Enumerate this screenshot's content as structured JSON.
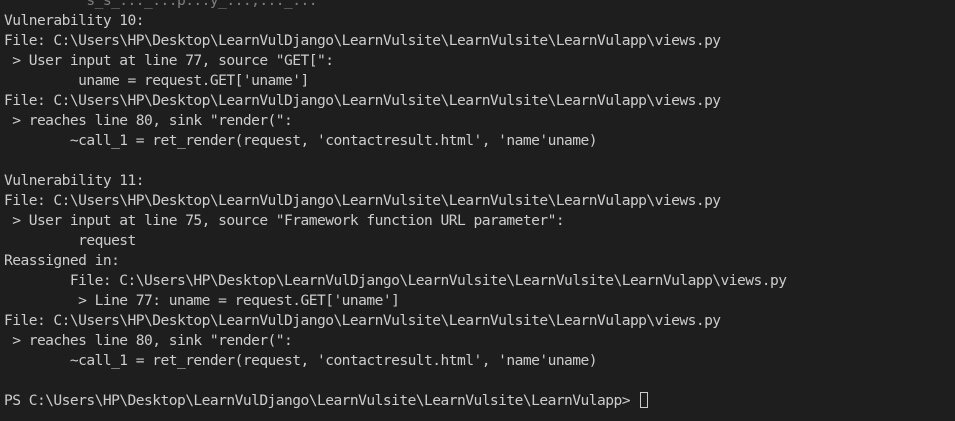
{
  "terminal": {
    "lines": [
      "          s_s_..._...p...y_...,..._...",
      "Vulnerability 10:",
      "File: C:\\Users\\HP\\Desktop\\LearnVulDjango\\LearnVulsite\\LearnVulsite\\LearnVulapp\\views.py",
      " > User input at line 77, source \"GET[\":",
      "         uname = request.GET['uname']",
      "File: C:\\Users\\HP\\Desktop\\LearnVulDjango\\LearnVulsite\\LearnVulsite\\LearnVulapp\\views.py",
      " > reaches line 80, sink \"render(\":",
      "        ~call_1 = ret_render(request, 'contactresult.html', 'name'uname)",
      "",
      "Vulnerability 11:",
      "File: C:\\Users\\HP\\Desktop\\LearnVulDjango\\LearnVulsite\\LearnVulsite\\LearnVulapp\\views.py",
      " > User input at line 75, source \"Framework function URL parameter\":",
      "         request",
      "Reassigned in:",
      "        File: C:\\Users\\HP\\Desktop\\LearnVulDjango\\LearnVulsite\\LearnVulsite\\LearnVulapp\\views.py",
      "         > Line 77: uname = request.GET['uname']",
      "File: C:\\Users\\HP\\Desktop\\LearnVulDjango\\LearnVulsite\\LearnVulsite\\LearnVulapp\\views.py",
      " > reaches line 80, sink \"render(\":",
      "        ~call_1 = ret_render(request, 'contactresult.html', 'name'uname)",
      "",
      ""
    ],
    "prompt": "PS C:\\Users\\HP\\Desktop\\LearnVulDjango\\LearnVulsite\\LearnVulsite\\LearnVulapp> "
  }
}
